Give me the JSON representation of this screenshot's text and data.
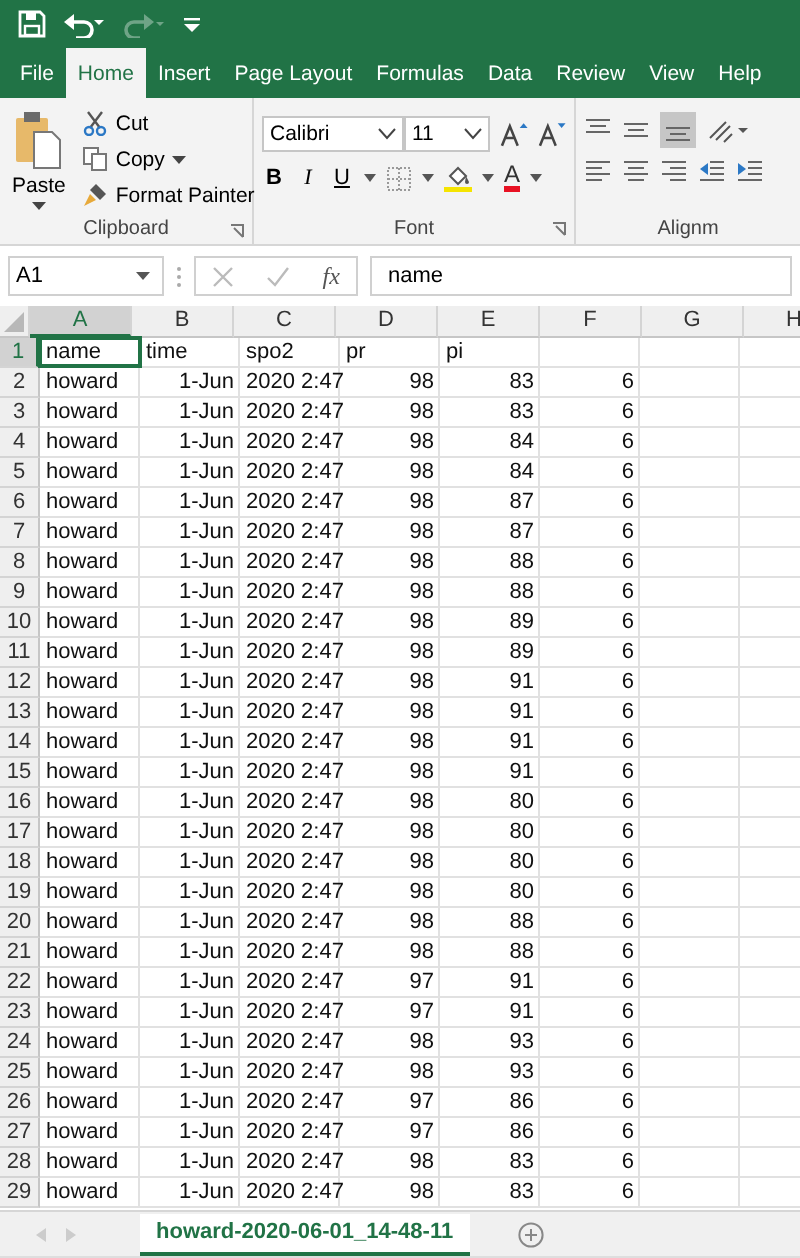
{
  "ribbon_tabs": [
    {
      "label": "File",
      "selected": false
    },
    {
      "label": "Home",
      "selected": true
    },
    {
      "label": "Insert",
      "selected": false
    },
    {
      "label": "Page Layout",
      "selected": false
    },
    {
      "label": "Formulas",
      "selected": false
    },
    {
      "label": "Data",
      "selected": false
    },
    {
      "label": "Review",
      "selected": false
    },
    {
      "label": "View",
      "selected": false
    },
    {
      "label": "Help",
      "selected": false
    }
  ],
  "quick_access": {
    "redo_disabled": true
  },
  "clipboard": {
    "label": "Clipboard",
    "paste": "Paste",
    "cut": "Cut",
    "copy": "Copy",
    "format_painter": "Format Painter"
  },
  "font": {
    "label": "Font",
    "family": "Calibri",
    "size": "11",
    "bold": "B",
    "italic": "I",
    "underline": "U",
    "font_color_letter": "A"
  },
  "alignment": {
    "label": "Alignm"
  },
  "formula_bar": {
    "name_box": "A1",
    "fx": "fx",
    "formula": "name"
  },
  "columns": [
    {
      "label": "A",
      "selected": true
    },
    {
      "label": "B",
      "selected": false
    },
    {
      "label": "C",
      "selected": false
    },
    {
      "label": "D",
      "selected": false
    },
    {
      "label": "E",
      "selected": false
    },
    {
      "label": "F",
      "selected": false
    },
    {
      "label": "G",
      "selected": false
    },
    {
      "label": "H",
      "selected": false
    }
  ],
  "rows": [
    {
      "number": "1",
      "selected": true,
      "kind": "header",
      "cells": [
        "name",
        "time",
        "spo2",
        "pr",
        "pi"
      ]
    },
    {
      "number": "2",
      "selected": false,
      "kind": "data",
      "cells": [
        "howard",
        "1-Jun",
        "2020 2:47",
        "98",
        "83",
        "6"
      ]
    },
    {
      "number": "3",
      "selected": false,
      "kind": "data",
      "cells": [
        "howard",
        "1-Jun",
        "2020 2:47",
        "98",
        "83",
        "6"
      ]
    },
    {
      "number": "4",
      "selected": false,
      "kind": "data",
      "cells": [
        "howard",
        "1-Jun",
        "2020 2:47",
        "98",
        "84",
        "6"
      ]
    },
    {
      "number": "5",
      "selected": false,
      "kind": "data",
      "cells": [
        "howard",
        "1-Jun",
        "2020 2:47",
        "98",
        "84",
        "6"
      ]
    },
    {
      "number": "6",
      "selected": false,
      "kind": "data",
      "cells": [
        "howard",
        "1-Jun",
        "2020 2:47",
        "98",
        "87",
        "6"
      ]
    },
    {
      "number": "7",
      "selected": false,
      "kind": "data",
      "cells": [
        "howard",
        "1-Jun",
        "2020 2:47",
        "98",
        "87",
        "6"
      ]
    },
    {
      "number": "8",
      "selected": false,
      "kind": "data",
      "cells": [
        "howard",
        "1-Jun",
        "2020 2:47",
        "98",
        "88",
        "6"
      ]
    },
    {
      "number": "9",
      "selected": false,
      "kind": "data",
      "cells": [
        "howard",
        "1-Jun",
        "2020 2:47",
        "98",
        "88",
        "6"
      ]
    },
    {
      "number": "10",
      "selected": false,
      "kind": "data",
      "cells": [
        "howard",
        "1-Jun",
        "2020 2:47",
        "98",
        "89",
        "6"
      ]
    },
    {
      "number": "11",
      "selected": false,
      "kind": "data",
      "cells": [
        "howard",
        "1-Jun",
        "2020 2:47",
        "98",
        "89",
        "6"
      ]
    },
    {
      "number": "12",
      "selected": false,
      "kind": "data",
      "cells": [
        "howard",
        "1-Jun",
        "2020 2:47",
        "98",
        "91",
        "6"
      ]
    },
    {
      "number": "13",
      "selected": false,
      "kind": "data",
      "cells": [
        "howard",
        "1-Jun",
        "2020 2:47",
        "98",
        "91",
        "6"
      ]
    },
    {
      "number": "14",
      "selected": false,
      "kind": "data",
      "cells": [
        "howard",
        "1-Jun",
        "2020 2:47",
        "98",
        "91",
        "6"
      ]
    },
    {
      "number": "15",
      "selected": false,
      "kind": "data",
      "cells": [
        "howard",
        "1-Jun",
        "2020 2:47",
        "98",
        "91",
        "6"
      ]
    },
    {
      "number": "16",
      "selected": false,
      "kind": "data",
      "cells": [
        "howard",
        "1-Jun",
        "2020 2:47",
        "98",
        "80",
        "6"
      ]
    },
    {
      "number": "17",
      "selected": false,
      "kind": "data",
      "cells": [
        "howard",
        "1-Jun",
        "2020 2:47",
        "98",
        "80",
        "6"
      ]
    },
    {
      "number": "18",
      "selected": false,
      "kind": "data",
      "cells": [
        "howard",
        "1-Jun",
        "2020 2:47",
        "98",
        "80",
        "6"
      ]
    },
    {
      "number": "19",
      "selected": false,
      "kind": "data",
      "cells": [
        "howard",
        "1-Jun",
        "2020 2:47",
        "98",
        "80",
        "6"
      ]
    },
    {
      "number": "20",
      "selected": false,
      "kind": "data",
      "cells": [
        "howard",
        "1-Jun",
        "2020 2:47",
        "98",
        "88",
        "6"
      ]
    },
    {
      "number": "21",
      "selected": false,
      "kind": "data",
      "cells": [
        "howard",
        "1-Jun",
        "2020 2:47",
        "98",
        "88",
        "6"
      ]
    },
    {
      "number": "22",
      "selected": false,
      "kind": "data",
      "cells": [
        "howard",
        "1-Jun",
        "2020 2:47",
        "97",
        "91",
        "6"
      ]
    },
    {
      "number": "23",
      "selected": false,
      "kind": "data",
      "cells": [
        "howard",
        "1-Jun",
        "2020 2:47",
        "97",
        "91",
        "6"
      ]
    },
    {
      "number": "24",
      "selected": false,
      "kind": "data",
      "cells": [
        "howard",
        "1-Jun",
        "2020 2:47",
        "98",
        "93",
        "6"
      ]
    },
    {
      "number": "25",
      "selected": false,
      "kind": "data",
      "cells": [
        "howard",
        "1-Jun",
        "2020 2:47",
        "98",
        "93",
        "6"
      ]
    },
    {
      "number": "26",
      "selected": false,
      "kind": "data",
      "cells": [
        "howard",
        "1-Jun",
        "2020 2:47",
        "97",
        "86",
        "6"
      ]
    },
    {
      "number": "27",
      "selected": false,
      "kind": "data",
      "cells": [
        "howard",
        "1-Jun",
        "2020 2:47",
        "97",
        "86",
        "6"
      ]
    },
    {
      "number": "28",
      "selected": false,
      "kind": "data",
      "cells": [
        "howard",
        "1-Jun",
        "2020 2:47",
        "98",
        "83",
        "6"
      ]
    },
    {
      "number": "29",
      "selected": false,
      "kind": "data",
      "cells": [
        "howard",
        "1-Jun",
        "2020 2:47",
        "98",
        "83",
        "6"
      ]
    }
  ],
  "sheet_tabs": [
    {
      "label": "howard-2020-06-01_14-48-11",
      "selected": true
    }
  ]
}
